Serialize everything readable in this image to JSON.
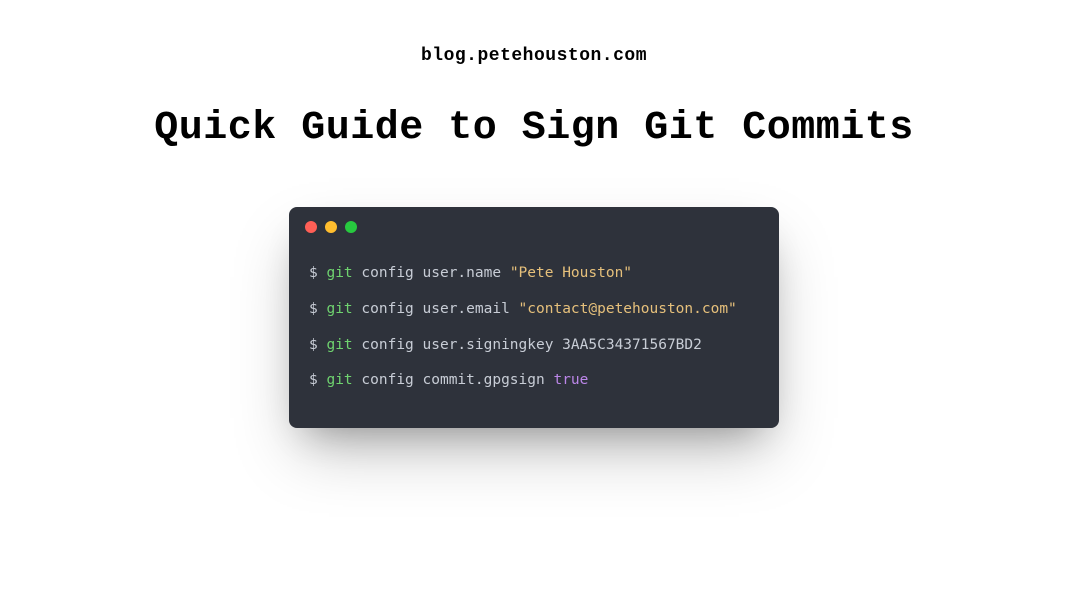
{
  "site_url": "blog.petehouston.com",
  "title": "Quick Guide to Sign Git Commits",
  "terminal": {
    "lines": [
      {
        "prompt": "$ ",
        "git": "git",
        "rest": " config user.name ",
        "string": "\"Pete Houston\"",
        "bool": ""
      },
      {
        "prompt": "$ ",
        "git": "git",
        "rest": " config user.email ",
        "string": "\"contact@petehouston.com\"",
        "bool": ""
      },
      {
        "prompt": "$ ",
        "git": "git",
        "rest": " config user.signingkey 3AA5C34371567BD2",
        "string": "",
        "bool": ""
      },
      {
        "prompt": "$ ",
        "git": "git",
        "rest": " config commit.gpgsign ",
        "string": "",
        "bool": "true"
      }
    ]
  }
}
